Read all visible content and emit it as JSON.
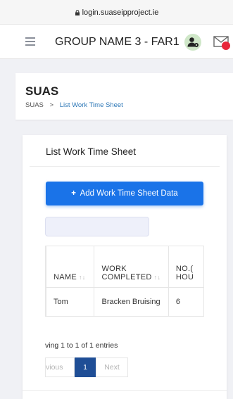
{
  "browser": {
    "url": "login.suaseipproject.ie"
  },
  "header": {
    "group_name": "GROUP NAME 3 -  FAR1"
  },
  "page": {
    "title": "SUAS",
    "breadcrumb": {
      "root": "SUAS",
      "separator": ">",
      "current": "List Work Time Sheet"
    }
  },
  "card": {
    "title": "List Work Time Sheet",
    "add_button": {
      "icon": "+",
      "label": "Add Work Time Sheet Data"
    },
    "search": {
      "value": ""
    }
  },
  "table": {
    "columns": [
      {
        "line1": "",
        "line2": "NAME"
      },
      {
        "line1": "WORK",
        "line2": "COMPLETED"
      },
      {
        "line1": "NO.(",
        "line2": "HOU"
      }
    ],
    "rows": [
      {
        "name": "Tom",
        "work_completed": "Bracken Bruising",
        "no_hours": "6"
      }
    ]
  },
  "footer": {
    "info": "ving 1 to 1 of 1 entries",
    "pagination": {
      "previous": "vious",
      "current": "1",
      "next": "Next"
    }
  },
  "colors": {
    "primary": "#1a73e8",
    "pager_active": "#1f4e96",
    "notification": "#e8263a"
  }
}
